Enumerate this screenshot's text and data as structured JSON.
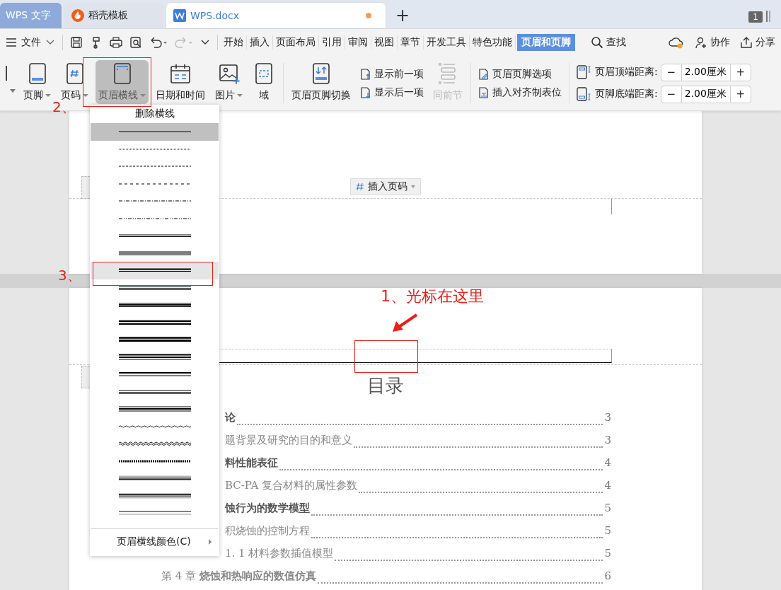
{
  "tabs": [
    {
      "label": "WPS 文字",
      "kind": "app",
      "selected": false,
      "modified": false
    },
    {
      "label": "稻壳模板",
      "kind": "docer",
      "selected": false,
      "modified": false
    },
    {
      "label": "WPS.docx",
      "kind": "doc",
      "selected": true,
      "modified": true
    }
  ],
  "new_tab": "+",
  "window_badge": "1",
  "menu": {
    "file": "文件",
    "tabs": [
      {
        "label": "开始",
        "selected": false
      },
      {
        "label": "插入",
        "selected": false
      },
      {
        "label": "页面布局",
        "selected": false
      },
      {
        "label": "引用",
        "selected": false
      },
      {
        "label": "审阅",
        "selected": false
      },
      {
        "label": "视图",
        "selected": false
      },
      {
        "label": "章节",
        "selected": false
      },
      {
        "label": "开发工具",
        "selected": false
      },
      {
        "label": "特色功能",
        "selected": false
      },
      {
        "label": "页眉和页脚",
        "selected": true
      }
    ],
    "search": "查找",
    "collab": "协作",
    "share": "分享"
  },
  "ribbon": {
    "large": [
      {
        "label": "页脚",
        "kind": "footer",
        "dropdown": true,
        "selected": false
      },
      {
        "label": "页码",
        "kind": "page-number",
        "dropdown": true,
        "selected": false
      },
      {
        "label": "页眉横线",
        "kind": "header-line",
        "dropdown": true,
        "selected": true
      },
      {
        "label": "日期和时间",
        "kind": "calendar",
        "dropdown": false,
        "selected": false
      },
      {
        "label": "图片",
        "kind": "image",
        "dropdown": true,
        "selected": false
      },
      {
        "label": "域",
        "kind": "field",
        "dropdown": false,
        "selected": false
      }
    ],
    "switch": "页眉页脚切换",
    "prev": "显示前一项",
    "next": "显示后一项",
    "same_as_previous": {
      "label": "同前节",
      "disabled": true
    },
    "options": "页眉页脚选项",
    "insert_tab": "插入对齐制表位",
    "spinners": [
      {
        "label": "页眉顶端距离:",
        "kind": "header",
        "decrement": "−",
        "value": "2.00厘米",
        "increment": "+"
      },
      {
        "label": "页脚底端距离:",
        "kind": "footer",
        "decrement": "−",
        "value": "2.00厘米",
        "increment": "+"
      }
    ]
  },
  "dropdown": {
    "title": "删除横线",
    "styles": [
      {
        "kind": "single",
        "selected": true,
        "hovered": false
      },
      {
        "kind": "dotted",
        "selected": false,
        "hovered": false
      },
      {
        "kind": "dashed",
        "selected": false,
        "hovered": false
      },
      {
        "kind": "long-dash",
        "selected": false,
        "hovered": false
      },
      {
        "kind": "dash-dot",
        "selected": false,
        "hovered": false
      },
      {
        "kind": "dash-dot-dot",
        "selected": false,
        "hovered": false
      },
      {
        "kind": "double",
        "selected": false,
        "hovered": false
      },
      {
        "kind": "triple",
        "selected": false,
        "hovered": false
      },
      {
        "kind": "thick-thin",
        "selected": false,
        "hovered": true
      },
      {
        "kind": "thin-thick",
        "selected": false,
        "hovered": false
      },
      {
        "kind": "thin-thick-thin",
        "selected": false,
        "hovered": false
      },
      {
        "kind": "thick-thick",
        "selected": false,
        "hovered": false
      },
      {
        "kind": "heavy-double",
        "selected": false,
        "hovered": false
      },
      {
        "kind": "thick-thick-thin",
        "selected": false,
        "hovered": false
      },
      {
        "kind": "thick-thin-wide",
        "selected": false,
        "hovered": false
      },
      {
        "kind": "thin-thick-wide",
        "selected": false,
        "hovered": false
      },
      {
        "kind": "thin-thick-thin-wide",
        "selected": false,
        "hovered": false
      },
      {
        "kind": "wave",
        "selected": false,
        "hovered": false
      },
      {
        "kind": "double-wave",
        "selected": false,
        "hovered": false
      },
      {
        "kind": "hatched",
        "selected": false,
        "hovered": false
      },
      {
        "kind": "emboss",
        "selected": false,
        "hovered": false
      },
      {
        "kind": "engrave",
        "selected": false,
        "hovered": false
      },
      {
        "kind": "thin-gray",
        "selected": false,
        "hovered": false
      }
    ],
    "color_option": "页眉横线颜色(C)"
  },
  "page": {
    "insert_page_number": "插入页码",
    "toc_title": "目录",
    "toc": [
      {
        "text": "论",
        "page": "3",
        "kind": "chapter"
      },
      {
        "text": "题背景及研究的目的和意义",
        "page": "3",
        "kind": "section"
      },
      {
        "text": "料性能表征",
        "page": "4",
        "kind": "chapter"
      },
      {
        "text": "BC-PA 复合材料的属性参数",
        "page": "4",
        "kind": "section"
      },
      {
        "text": "蚀行为的数学模型",
        "page": "5",
        "kind": "chapter"
      },
      {
        "text": "积烧蚀的控制方程",
        "page": "5",
        "kind": "section"
      },
      {
        "text": "1. 1  材料参数插值模型",
        "page": "5",
        "kind": "section"
      },
      {
        "text": "第 4 章  **烧蚀和热响应的数值仿真**",
        "page": "6",
        "kind": "section"
      }
    ]
  },
  "annotations": [
    "2、",
    "3、",
    "1、光标在这里"
  ]
}
